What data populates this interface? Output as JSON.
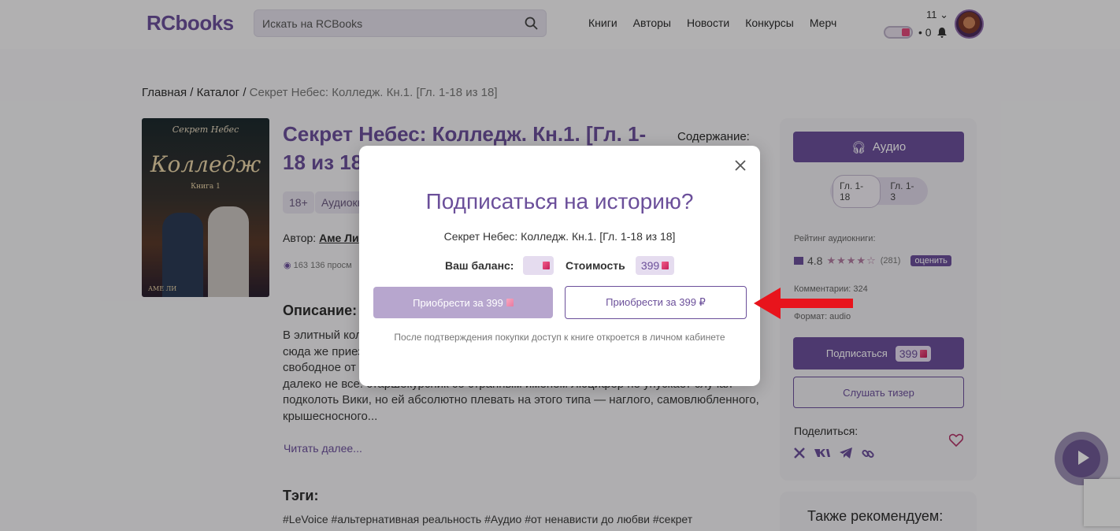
{
  "header": {
    "logo": "RCbooks",
    "search_placeholder": "Искать на RCBooks",
    "nav": [
      "Книги",
      "Авторы",
      "Новости",
      "Конкурсы",
      "Мерч"
    ],
    "count": "11",
    "notifications": "• 0"
  },
  "breadcrumb": {
    "home": "Главная",
    "sep": "/",
    "catalog": "Каталог",
    "current": "Секрет Небес: Колледж. Кн.1. [Гл. 1-18 из 18]"
  },
  "cover": {
    "series": "Секрет Небес",
    "title": "Колледж",
    "book": "Книга 1",
    "author": "АМЕ ЛИ"
  },
  "book": {
    "title": "Секрет Небес: Колледж. Кн.1. [Гл. 1-18 из 18]",
    "content_label": "Содержание:",
    "age": "18+",
    "format_tag": "Аудиокн",
    "author_label": "Автор:",
    "author": "Аме Ли",
    "views": "163 136 просм",
    "description_heading": "Описание:",
    "description": "В элитный колледж, куда попадают дети очень богатых и влиятельных родителей, — сюда же приезжает Вики. В старинном особняке после смерти отца она хочет начать свободное от прошлого будущее, но в академии всё иначе. Новенькой здесь рады далеко не все: старшекурсник со странным именем Люцифер не упускает случая подколоть Вики, но ей абсолютно плевать на этого типа — наглого, самовлюбленного, крышесносного...",
    "read_more": "Читать далее...",
    "tags_heading": "Тэги:",
    "tags": "#LeVoice #альтернативная реальность #Аудио #от ненависти до любви #секрет"
  },
  "sidebar": {
    "audio_button": "Аудио",
    "segments": [
      "Гл. 1-18",
      "Гл. 1-3"
    ],
    "rating_label": "Рейтинг аудиокниги:",
    "rating": "4.8",
    "stars": "★★★★☆",
    "rating_count": "(281)",
    "rate_button": "оценить",
    "comments": "Комментарии: 324",
    "format": "Формат: audio",
    "subscribe_button": "Подписаться",
    "subscribe_price": "399",
    "teaser_button": "Слушать тизер",
    "share_label": "Поделиться:",
    "recommend_heading": "Также рекомендуем:"
  },
  "modal": {
    "title": "Подписаться на историю?",
    "book": "Секрет Небес: Колледж. Кн.1. [Гл. 1-18 из 18]",
    "balance_label": "Ваш баланс:",
    "cost_label": "Стоимость",
    "cost_value": "399",
    "buy_gems": "Приобрести за 399",
    "buy_rub": "Приобрести за 399 ₽",
    "note": "После подтверждения покупки доступ к книге откроется в личном кабинете"
  },
  "colors": {
    "accent": "#6b4f9a",
    "gem": "#e04a7a",
    "arrow": "#e8141c"
  }
}
